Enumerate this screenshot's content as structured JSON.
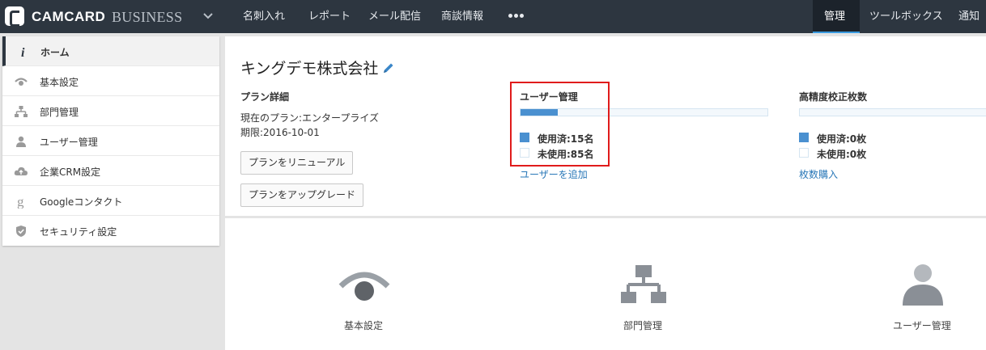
{
  "header": {
    "brand_main": "CAMCARD",
    "brand_sub": "BUSINESS",
    "nav": [
      "名刺入れ",
      "レポート",
      "メール配信",
      "商談情報"
    ],
    "more_icon": "more-dots-icon",
    "active": "管理",
    "toolbox": "ツールボックス",
    "notice": "通知"
  },
  "sidebar": {
    "items": [
      {
        "label": "ホーム",
        "icon": "info-icon"
      },
      {
        "label": "基本設定",
        "icon": "eye-icon"
      },
      {
        "label": "部門管理",
        "icon": "org-chart-icon"
      },
      {
        "label": "ユーザー管理",
        "icon": "user-icon"
      },
      {
        "label": "企業CRM設定",
        "icon": "cloud-icon"
      },
      {
        "label": "Googleコンタクト",
        "icon": "google-icon"
      },
      {
        "label": "セキュリティ設定",
        "icon": "shield-icon"
      }
    ]
  },
  "main": {
    "company": "キングデモ株式会社",
    "plan": {
      "title": "プラン詳細",
      "current": "現在のプラン:エンタープライズ",
      "expiry": "期限:2016-10-01",
      "renew_button": "プランをリニューアル",
      "upgrade_button": "プランをアップグレード"
    },
    "users": {
      "title": "ユーザー管理",
      "used_fraction": 0.15,
      "used": "使用済:15名",
      "unused": "未使用:85名",
      "add_link": "ユーザーを追加"
    },
    "accuracy": {
      "title": "高精度校正枚数",
      "used_fraction": 0.0,
      "used": "使用済:0枚",
      "unused": "未使用:0枚",
      "buy_link": "枚数購入"
    }
  },
  "tiles": [
    {
      "label": "基本設定",
      "icon": "eye-icon"
    },
    {
      "label": "部門管理",
      "icon": "org-chart-icon"
    },
    {
      "label": "ユーザー管理",
      "icon": "user-icon"
    }
  ],
  "colors": {
    "header_bg": "#2d3640",
    "accent": "#4a90d0",
    "highlight": "#e01b1b",
    "link": "#2a78b8"
  }
}
